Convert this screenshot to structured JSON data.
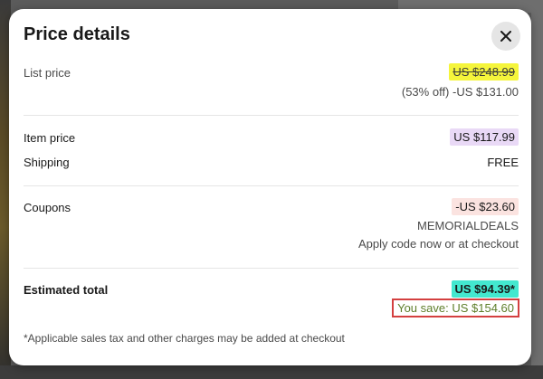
{
  "modal": {
    "title": "Price details",
    "close_icon": "close-icon"
  },
  "list_price": {
    "label": "List price",
    "value": "US $248.99",
    "discount": "(53% off) -US $131.00"
  },
  "item_price": {
    "label": "Item price",
    "value": "US $117.99"
  },
  "shipping": {
    "label": "Shipping",
    "value": "FREE"
  },
  "coupons": {
    "label": "Coupons",
    "value": "-US $23.60",
    "code": "MEMORIALDEALS",
    "hint": "Apply code now or at checkout"
  },
  "estimated_total": {
    "label": "Estimated total",
    "value": "US $94.39*",
    "savings": "You save: US $154.60"
  },
  "footnote": "*Applicable sales tax and other charges may be added at checkout",
  "colors": {
    "list_price_highlight": "#f5f53b",
    "item_price_highlight": "#e9d9f6",
    "coupon_highlight": "#fbe3e0",
    "total_highlight": "#43e8cf",
    "savings_text": "#5e7e2a",
    "savings_border": "#d44040"
  }
}
